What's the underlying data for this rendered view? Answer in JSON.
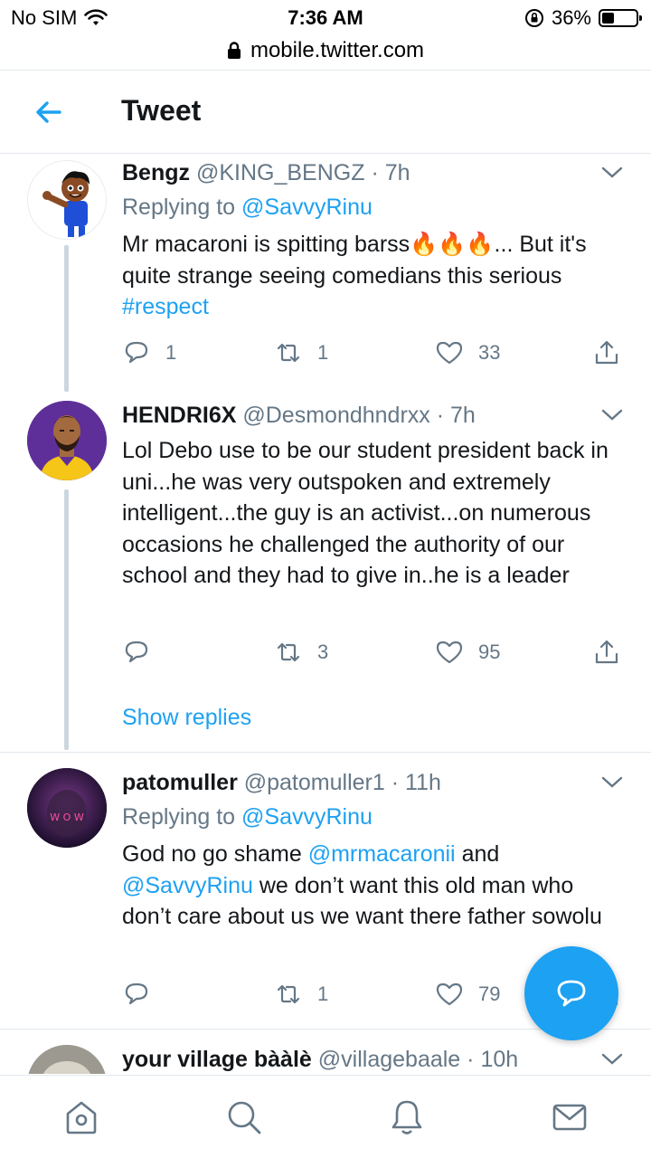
{
  "status_bar": {
    "carrier": "No SIM",
    "time": "7:36 AM",
    "battery_percent": "36%",
    "battery_level": 0.36
  },
  "browser": {
    "url": "mobile.twitter.com"
  },
  "header": {
    "title": "Tweet"
  },
  "tweets": [
    {
      "name": "Bengz",
      "handle": "@KING_BENGZ",
      "separator": "·",
      "time": "7h",
      "replying_prefix": "Replying to",
      "replying_to": "@SavvyRinu",
      "text_before": "Mr macaroni is spitting barss",
      "emoji": "🔥🔥🔥",
      "text_after": "... But it's quite strange seeing comedians this serious",
      "hashtag": "#respect",
      "replies": "1",
      "retweets": "1",
      "likes": "33"
    },
    {
      "name": "HENDRI6X",
      "handle": "@Desmondhndrxx",
      "separator": "·",
      "time": "7h",
      "text": "Lol Debo use to be our student president back in uni...he was very outspoken and extremely intelligent...the guy is an activist...on numerous occasions he challenged the authority of our school and they had to give in..he is a leader",
      "replies": "",
      "retweets": "3",
      "likes": "95"
    },
    {
      "name": "patomuller",
      "handle": "@patomuller1",
      "separator": "·",
      "time": "11h",
      "replying_prefix": "Replying to",
      "replying_to": "@SavvyRinu",
      "text_before": "God no go shame",
      "mention1": "@mrmacaronii",
      "text_mid": "and",
      "mention2": "@SavvyRinu",
      "text_after": "we don’t want this old man who don’t care about us we want there father sowolu",
      "replies": "",
      "retweets": "1",
      "likes": "79"
    },
    {
      "name": "your village bààlè",
      "handle": "@villagebaale",
      "separator": "·",
      "time": "10h"
    }
  ],
  "show_replies": "Show replies",
  "avatar_text": "W O W",
  "icons": {
    "back": "arrow-left-icon",
    "chevron": "chevron-down-icon",
    "reply": "reply-icon",
    "retweet": "retweet-icon",
    "like": "heart-icon",
    "share": "share-icon",
    "compose": "compose-message-icon",
    "nav": [
      "home-icon",
      "search-icon",
      "notifications-icon",
      "messages-icon"
    ]
  },
  "colors": {
    "accent": "#1da1f2",
    "muted": "#657786",
    "text": "#14171a",
    "divider": "#e1e8ed"
  }
}
